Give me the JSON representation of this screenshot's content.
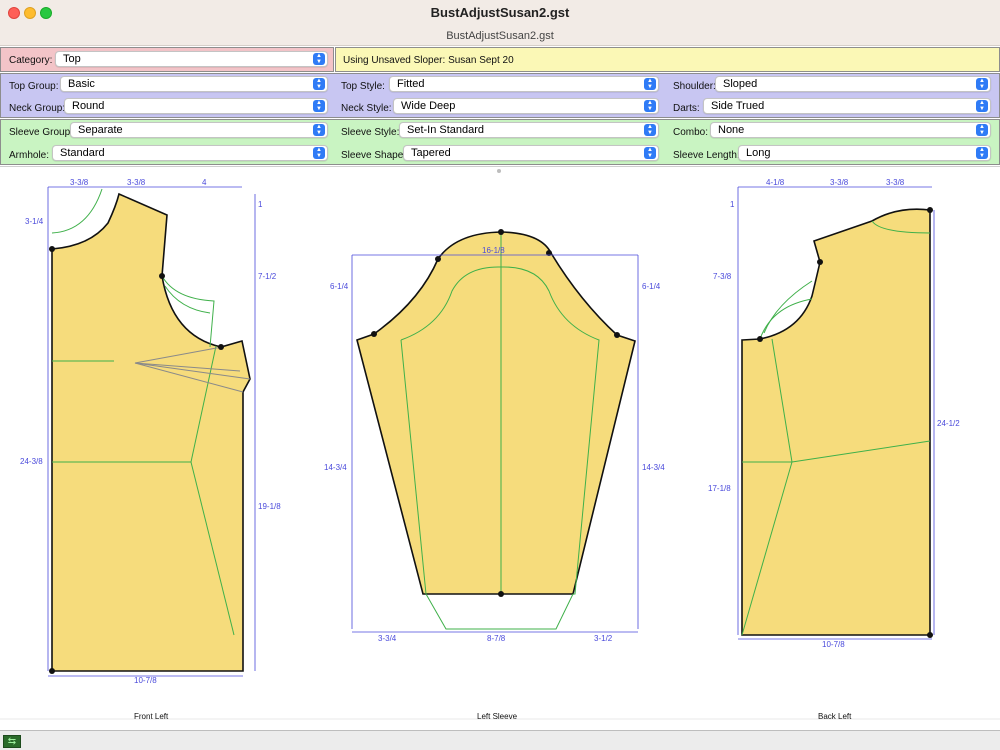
{
  "window": {
    "title": "BustAdjustSusan2.gst",
    "subtitle": "BustAdjustSusan2.gst"
  },
  "category": {
    "label": "Category:",
    "value": "Top"
  },
  "sloper": {
    "label": "Using Unsaved Sloper:",
    "value": "Susan Sept 20"
  },
  "top_panel": {
    "top_group": {
      "label": "Top Group:",
      "value": "Basic"
    },
    "neck_group": {
      "label": "Neck Group:",
      "value": "Round"
    },
    "top_style": {
      "label": "Top Style:",
      "value": "Fitted"
    },
    "neck_style": {
      "label": "Neck Style:",
      "value": "Wide Deep"
    },
    "shoulder": {
      "label": "Shoulder:",
      "value": "Sloped"
    },
    "darts": {
      "label": "Darts:",
      "value": "Side Trued"
    }
  },
  "sleeve_panel": {
    "sleeve_group": {
      "label": "Sleeve Group:",
      "value": "Separate"
    },
    "armhole": {
      "label": "Armhole:",
      "value": "Standard"
    },
    "sleeve_style": {
      "label": "Sleeve Style:",
      "value": "Set-In Standard"
    },
    "sleeve_shape": {
      "label": "Sleeve Shape:",
      "value": "Tapered"
    },
    "combo": {
      "label": "Combo:",
      "value": "None"
    },
    "sleeve_length": {
      "label": "Sleeve Length:",
      "value": "Long"
    }
  },
  "colors": {
    "fabric": "#f6dc7c",
    "measure": "#4a4adb",
    "guide": "#3fb04a",
    "dart": "#8a8a8a"
  },
  "pieces": {
    "front_left": {
      "caption": "Front Left",
      "dims": [
        "3-3/8",
        "3-3/8",
        "4",
        "3-1/4",
        "1",
        "7-1/2",
        "24-3/8",
        "19-1/8",
        "10-7/8"
      ]
    },
    "left_sleeve": {
      "caption": "Left Sleeve",
      "dims": [
        "16-1/8",
        "6-1/4",
        "6-1/4",
        "14-3/4",
        "14-3/4",
        "3-3/4",
        "8-7/8",
        "3-1/2"
      ]
    },
    "back_left": {
      "caption": "Back Left",
      "dims": [
        "4-1/8",
        "3-3/8",
        "3-3/8",
        "1",
        "7-3/8",
        "24-1/2",
        "17-1/8",
        "10-7/8"
      ]
    }
  },
  "status": {
    "icon": "sync-icon"
  }
}
